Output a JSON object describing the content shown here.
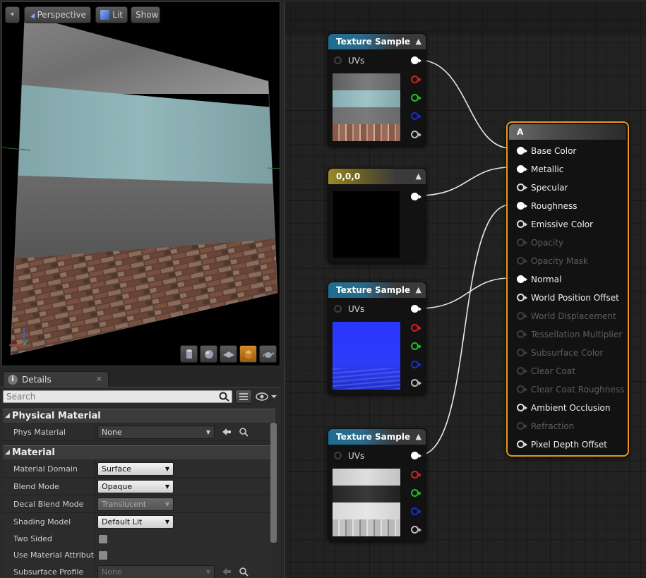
{
  "viewport": {
    "menu_arrow": "▾",
    "perspective_label": "Perspective",
    "lit_label": "Lit",
    "show_label": "Show",
    "shape_buttons": [
      "cylinder-icon",
      "sphere-icon",
      "plane-icon",
      "cube-icon",
      "teapot-icon"
    ]
  },
  "details": {
    "tab_title": "Details",
    "tab_close": "×",
    "search_placeholder": "Search",
    "categories": [
      {
        "title": "Physical Material"
      },
      {
        "title": "Material"
      }
    ],
    "phys_material": {
      "label": "Phys Material",
      "value": "None"
    },
    "properties": [
      {
        "label": "Material Domain",
        "value": "Surface",
        "enabled": true
      },
      {
        "label": "Blend Mode",
        "value": "Opaque",
        "enabled": true
      },
      {
        "label": "Decal Blend Mode",
        "value": "Translucent",
        "enabled": false
      },
      {
        "label": "Shading Model",
        "value": "Default Lit",
        "enabled": true
      },
      {
        "label": "Two Sided",
        "type": "checkbox",
        "checked": false
      },
      {
        "label": "Use Material Attributes",
        "type": "checkbox",
        "checked": false
      },
      {
        "label": "Subsurface Profile",
        "value": "None",
        "enabled": false
      }
    ]
  },
  "graph": {
    "nodes": [
      {
        "id": "tex1",
        "title": "Texture Sample",
        "input": "UVs",
        "colors": {
          "preview": [
            "#6b6b6b",
            "#8ab0b5",
            "#7a7a7a",
            "#a17b6a"
          ]
        }
      },
      {
        "id": "const",
        "title": "0,0,0",
        "preview_color": "#000000"
      },
      {
        "id": "tex2",
        "title": "Texture Sample",
        "input": "UVs",
        "preview_color": "#2a35ff"
      },
      {
        "id": "tex3",
        "title": "Texture Sample",
        "input": "UVs",
        "colors": {
          "preview": [
            "#cfcfcf",
            "#2e2e2e",
            "#dadada",
            "#bdbdbd"
          ]
        }
      }
    ],
    "material": {
      "title": "A",
      "pins": [
        {
          "label": "Base Color",
          "active": true,
          "connected": true
        },
        {
          "label": "Metallic",
          "active": true,
          "connected": true
        },
        {
          "label": "Specular",
          "active": true,
          "connected": false
        },
        {
          "label": "Roughness",
          "active": true,
          "connected": true
        },
        {
          "label": "Emissive Color",
          "active": true,
          "connected": false
        },
        {
          "label": "Opacity",
          "active": false,
          "connected": false
        },
        {
          "label": "Opacity Mask",
          "active": false,
          "connected": false
        },
        {
          "label": "Normal",
          "active": true,
          "connected": true
        },
        {
          "label": "World Position Offset",
          "active": true,
          "connected": false
        },
        {
          "label": "World Displacement",
          "active": false,
          "connected": false
        },
        {
          "label": "Tessellation Multiplier",
          "active": false,
          "connected": false
        },
        {
          "label": "Subsurface Color",
          "active": false,
          "connected": false
        },
        {
          "label": "Clear Coat",
          "active": false,
          "connected": false
        },
        {
          "label": "Clear Coat Roughness",
          "active": false,
          "connected": false
        },
        {
          "label": "Ambient Occlusion",
          "active": true,
          "connected": false
        },
        {
          "label": "Refraction",
          "active": false,
          "connected": false
        },
        {
          "label": "Pixel Depth Offset",
          "active": true,
          "connected": false
        }
      ]
    },
    "accent": "#e8961e"
  }
}
